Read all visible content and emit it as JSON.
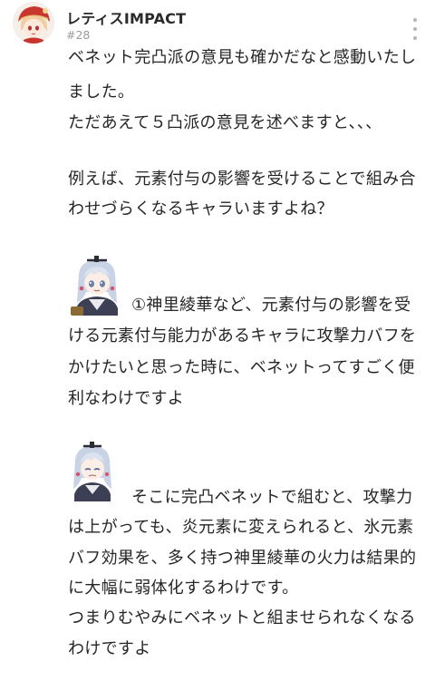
{
  "post": {
    "username": "レティスIMPACT",
    "number": "#28",
    "avatar_icon": "klee-avatar-icon",
    "more_icon": "more-vertical-icon",
    "sticker_icon": "ayaka-sticker-icon",
    "lines": [
      "ベネット完凸派の意見も確かだなと感動いたし",
      "ました。",
      "ただあえて５凸派の意見を述べますと、、、",
      "例えば、元素付与の影響を受けることで組み合",
      "わせづらくなるキャラいますよね？",
      "①神里綾華など、元素付与の影響を受",
      "ける元素付与能力があるキャラに攻撃力バフを",
      "かけたいと思った時に、ベネットってすごく便",
      "利なわけですよ",
      "そこに完凸ベネットで組むと、攻撃力",
      "は上がっても、炎元素に変えられると、氷元素",
      "バフ効果を、多く持つ神里綾華の火力は結果的",
      "に大幅に弱体化するわけです。",
      "つまりむやみにベネットと組ませられなくなる",
      "わけですよ"
    ]
  }
}
